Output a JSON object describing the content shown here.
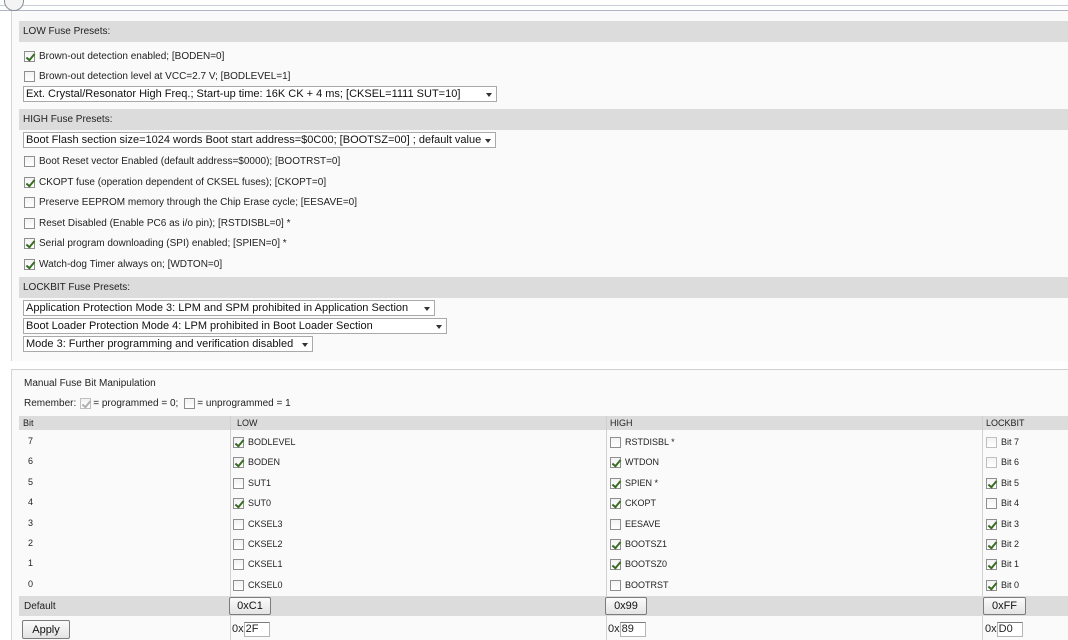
{
  "low": {
    "header": "LOW Fuse Presets:",
    "checks": [
      {
        "label": "Brown-out detection enabled; [BODEN=0]",
        "checked": true
      },
      {
        "label": "Brown-out detection level at VCC=2.7 V; [BODLEVEL=1]",
        "checked": false
      }
    ],
    "select": "Ext. Crystal/Resonator High Freq.; Start-up time: 16K CK + 4 ms; [CKSEL=1111 SUT=10]"
  },
  "high": {
    "header": "HIGH Fuse Presets:",
    "select": "Boot Flash section size=1024 words Boot start address=$0C00; [BOOTSZ=00] ; default value",
    "checks": [
      {
        "label": "Boot Reset vector Enabled (default address=$0000); [BOOTRST=0]",
        "checked": false
      },
      {
        "label": "CKOPT fuse (operation dependent of CKSEL fuses); [CKOPT=0]",
        "checked": true
      },
      {
        "label": "Preserve EEPROM memory through the Chip Erase cycle; [EESAVE=0]",
        "checked": false
      },
      {
        "label": "Reset Disabled (Enable PC6 as i/o pin); [RSTDISBL=0] *",
        "checked": false
      },
      {
        "label": "Serial program downloading (SPI) enabled; [SPIEN=0] *",
        "checked": true
      },
      {
        "label": "Watch-dog Timer always on; [WDTON=0]",
        "checked": true
      }
    ]
  },
  "lockbit": {
    "header": "LOCKBIT Fuse Presets:",
    "selects": [
      "Application Protection Mode 3: LPM and SPM prohibited in Application Section",
      "Boot Loader Protection Mode 4: LPM prohibited in Boot Loader Section",
      "Mode 3: Further programming and verification disabled"
    ]
  },
  "manual": {
    "title": "Manual Fuse Bit Manipulation",
    "remember_label": "Remember:",
    "programmed_label": "= programmed = 0;",
    "unprogrammed_label": "= unprogrammed = 1",
    "columns": [
      "Bit",
      "LOW",
      "HIGH",
      "LOCKBIT"
    ],
    "rows": [
      {
        "bit": "7",
        "low": {
          "label": "BODLEVEL",
          "checked": true
        },
        "high": {
          "label": "RSTDISBL *",
          "checked": false
        },
        "lock": {
          "label": "Bit 7",
          "checked": false,
          "dim": true
        }
      },
      {
        "bit": "6",
        "low": {
          "label": "BODEN",
          "checked": true
        },
        "high": {
          "label": "WTDON",
          "checked": true
        },
        "lock": {
          "label": "Bit 6",
          "checked": false,
          "dim": true
        }
      },
      {
        "bit": "5",
        "low": {
          "label": "SUT1",
          "checked": false
        },
        "high": {
          "label": "SPIEN *",
          "checked": true
        },
        "lock": {
          "label": "Bit 5",
          "checked": true,
          "dim": false
        }
      },
      {
        "bit": "4",
        "low": {
          "label": "SUT0",
          "checked": true
        },
        "high": {
          "label": "CKOPT",
          "checked": true
        },
        "lock": {
          "label": "Bit 4",
          "checked": false,
          "dim": false
        }
      },
      {
        "bit": "3",
        "low": {
          "label": "CKSEL3",
          "checked": false
        },
        "high": {
          "label": "EESAVE",
          "checked": false
        },
        "lock": {
          "label": "Bit 3",
          "checked": true,
          "dim": false
        }
      },
      {
        "bit": "2",
        "low": {
          "label": "CKSEL2",
          "checked": false
        },
        "high": {
          "label": "BOOTSZ1",
          "checked": true
        },
        "lock": {
          "label": "Bit 2",
          "checked": true,
          "dim": false
        }
      },
      {
        "bit": "1",
        "low": {
          "label": "CKSEL1",
          "checked": false
        },
        "high": {
          "label": "BOOTSZ0",
          "checked": true
        },
        "lock": {
          "label": "Bit 1",
          "checked": true,
          "dim": false
        }
      },
      {
        "bit": "0",
        "low": {
          "label": "CKSEL0",
          "checked": false
        },
        "high": {
          "label": "BOOTRST",
          "checked": false
        },
        "lock": {
          "label": "Bit 0",
          "checked": true,
          "dim": false
        }
      }
    ],
    "default_label": "Default",
    "defaults": {
      "low": "0xC1",
      "high": "0x99",
      "lock": "0xFF"
    },
    "apply_label": "Apply",
    "hex_prefix": "0x",
    "values": {
      "low": "2F",
      "high": "89",
      "lock": "D0"
    }
  },
  "icons": {
    "checkbox": "checkbox-icon",
    "dropdown": "chevron-down-icon"
  }
}
